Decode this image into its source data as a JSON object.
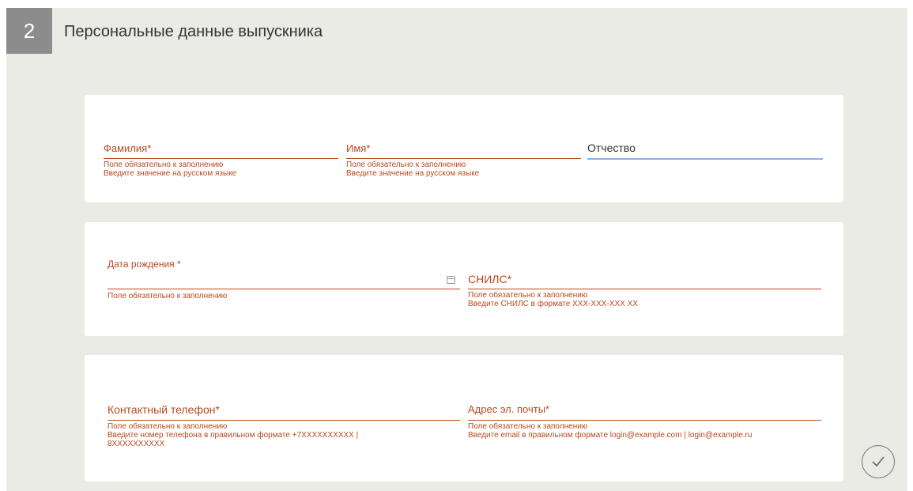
{
  "section": {
    "number": "2",
    "title": "Персональные данные выпускника"
  },
  "card1": {
    "surname": {
      "label": "Фамилия*",
      "hint1": "Поле обязательно к заполнению",
      "hint2": "Введите значение на русском языке"
    },
    "name": {
      "label": "Имя*",
      "hint1": "Поле обязательно к заполнению",
      "hint2": "Введите значение на русском языке"
    },
    "patronymic": {
      "label": "Отчество"
    }
  },
  "card2": {
    "birthdate": {
      "label": "Дата рождения *",
      "hint1": "Поле обязательно к заполнению"
    },
    "snils": {
      "label": "СНИЛС*",
      "hint1": "Поле обязательно к заполнению",
      "hint2": "Введите СНИЛС в формате XXX-XXX-XXX XX"
    }
  },
  "card3": {
    "phone": {
      "label": "Контактный телефон*",
      "hint1": "Поле обязательно к заполнению",
      "hint2": "Введите номер телефона в правильном формате +7XXXXXXXXXX | 8XXXXXXXXXX"
    },
    "email": {
      "label": "Адрес эл. почты*",
      "hint1": "Поле обязательно к заполнению",
      "hint2": "Введите email в правильном формате login@example.com | login@example.ru"
    }
  },
  "icons": {
    "calendar": "calendar-icon",
    "submit": "checkmark-circle-icon"
  },
  "colors": {
    "error": "#b8491e",
    "focus": "#8fb1e8",
    "background": "#ebebe6",
    "step_badge": "#8c8c8c"
  }
}
